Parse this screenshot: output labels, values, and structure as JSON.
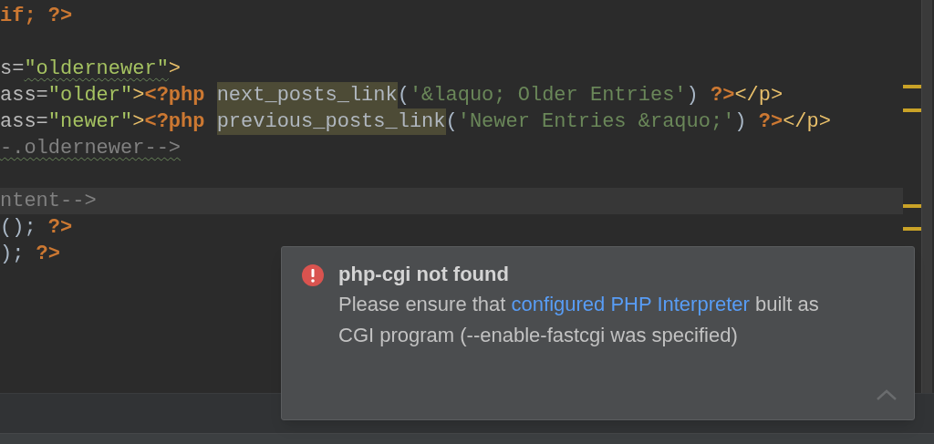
{
  "editor": {
    "lines": [
      {
        "current": false,
        "tokens": [
          {
            "kind": "keyword",
            "text": "if; ?>"
          }
        ]
      },
      {
        "current": false
      },
      {
        "current": false,
        "tokens": [
          {
            "kind": "attribute",
            "text": "s="
          },
          {
            "kind": "value",
            "text": "\"oldernewer\"",
            "wavy": true
          },
          {
            "kind": "tag",
            "text": ">"
          }
        ]
      },
      {
        "current": false,
        "tokens": [
          {
            "kind": "attribute",
            "text": "ass="
          },
          {
            "kind": "value",
            "text": "\"older\""
          },
          {
            "kind": "tag",
            "text": ">"
          },
          {
            "kind": "keyword",
            "text": "<?php "
          },
          {
            "kind": "function",
            "text": "next_posts_link",
            "marked": true
          },
          {
            "kind": "paren",
            "text": "("
          },
          {
            "kind": "string",
            "text": "'&laquo; Older Entries'"
          },
          {
            "kind": "paren",
            "text": ") "
          },
          {
            "kind": "keyword",
            "text": "?>"
          },
          {
            "kind": "tag",
            "text": "</p>"
          }
        ]
      },
      {
        "current": false,
        "tokens": [
          {
            "kind": "attribute",
            "text": "ass="
          },
          {
            "kind": "value",
            "text": "\"newer\""
          },
          {
            "kind": "tag",
            "text": ">"
          },
          {
            "kind": "keyword",
            "text": "<?php "
          },
          {
            "kind": "function",
            "text": "previous_posts_link",
            "marked": true
          },
          {
            "kind": "paren",
            "text": "("
          },
          {
            "kind": "string",
            "text": "'Newer Entries &raquo;'"
          },
          {
            "kind": "paren",
            "text": ") "
          },
          {
            "kind": "keyword",
            "text": "?>"
          },
          {
            "kind": "tag",
            "text": "</p>"
          }
        ]
      },
      {
        "current": false,
        "tokens": [
          {
            "kind": "comment",
            "text": "-.oldernewer-->",
            "wavy": true
          }
        ]
      },
      {
        "current": false
      },
      {
        "current": true,
        "tokens": [
          {
            "kind": "comment",
            "text": "ntent-->"
          }
        ]
      },
      {
        "current": false,
        "tokens": [
          {
            "kind": "paren",
            "text": "();"
          },
          {
            "kind": "keyword",
            "text": " ?>"
          }
        ]
      },
      {
        "current": false,
        "tokens": [
          {
            "kind": "paren",
            "text": ");"
          },
          {
            "kind": "keyword",
            "text": " ?>"
          }
        ]
      }
    ]
  },
  "notification": {
    "title": "php-cgi not found",
    "body_before": "Please ensure that",
    "link": "configured PHP Interpreter",
    "body_after": "built as CGI program (--enable-fastcgi was specified)"
  }
}
